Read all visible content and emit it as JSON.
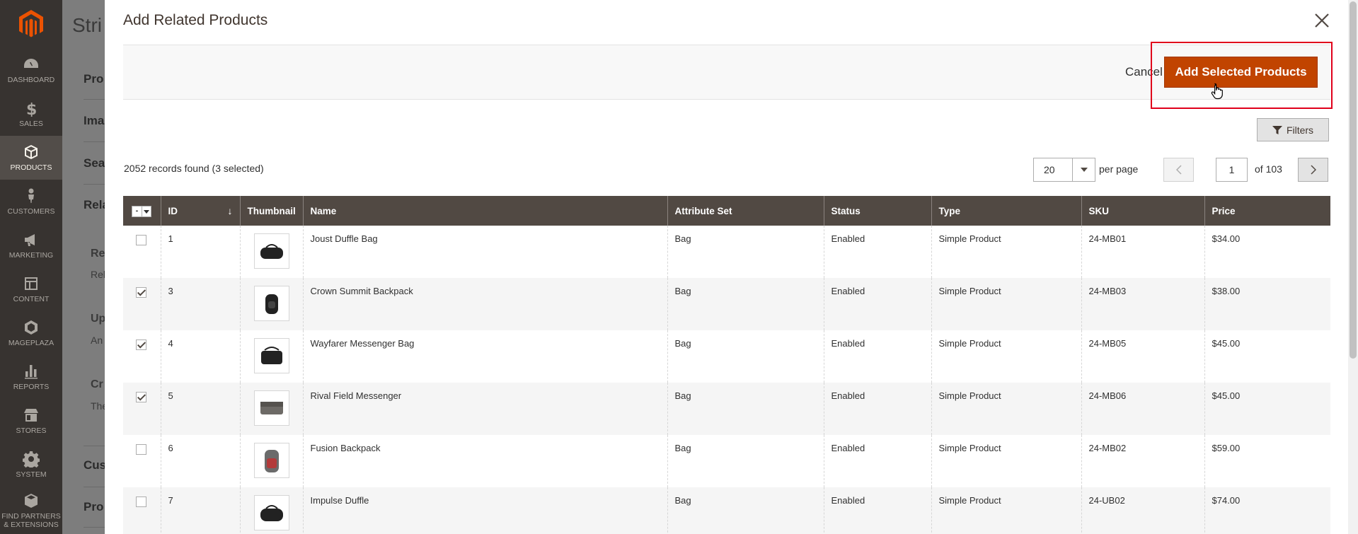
{
  "sidebar": {
    "items": [
      {
        "label": "DASHBOARD",
        "icon": "dashboard-icon"
      },
      {
        "label": "SALES",
        "icon": "dollar-icon"
      },
      {
        "label": "PRODUCTS",
        "icon": "cube-icon",
        "active": true
      },
      {
        "label": "CUSTOMERS",
        "icon": "person-icon"
      },
      {
        "label": "MARKETING",
        "icon": "megaphone-icon"
      },
      {
        "label": "CONTENT",
        "icon": "layout-icon"
      },
      {
        "label": "MAGEPLAZA",
        "icon": "hexagon-icon"
      },
      {
        "label": "REPORTS",
        "icon": "bar-chart-icon"
      },
      {
        "label": "STORES",
        "icon": "store-icon"
      },
      {
        "label": "SYSTEM",
        "icon": "gear-icon"
      },
      {
        "label": "FIND PARTNERS & EXTENSIONS",
        "icon": "box-icon"
      }
    ]
  },
  "background": {
    "title": "Stri",
    "items": [
      "Pro",
      "Ima",
      "Sea",
      "Rela",
      "Cus",
      "Pro"
    ],
    "subs": [
      "Re",
      "Rel",
      "Up",
      "An",
      "Cr",
      "The"
    ]
  },
  "modal": {
    "title": "Add Related Products",
    "cancel_label": "Cancel",
    "primary_label": "Add Selected Products",
    "filters_label": "Filters",
    "records_text": "2052 records found (3 selected)",
    "per_page_value": "20",
    "per_page_label": "per page",
    "current_page": "1",
    "page_of": "of 103"
  },
  "grid": {
    "columns": [
      "ID",
      "Thumbnail",
      "Name",
      "Attribute Set",
      "Status",
      "Type",
      "SKU",
      "Price"
    ],
    "mass_select_label": "-",
    "rows": [
      {
        "checked": false,
        "id": "1",
        "name": "Joust Duffle Bag",
        "attribute_set": "Bag",
        "status": "Enabled",
        "type": "Simple Product",
        "sku": "24-MB01",
        "price": "$34.00"
      },
      {
        "checked": true,
        "id": "3",
        "name": "Crown Summit Backpack",
        "attribute_set": "Bag",
        "status": "Enabled",
        "type": "Simple Product",
        "sku": "24-MB03",
        "price": "$38.00"
      },
      {
        "checked": true,
        "id": "4",
        "name": "Wayfarer Messenger Bag",
        "attribute_set": "Bag",
        "status": "Enabled",
        "type": "Simple Product",
        "sku": "24-MB05",
        "price": "$45.00"
      },
      {
        "checked": true,
        "id": "5",
        "name": "Rival Field Messenger",
        "attribute_set": "Bag",
        "status": "Enabled",
        "type": "Simple Product",
        "sku": "24-MB06",
        "price": "$45.00"
      },
      {
        "checked": false,
        "id": "6",
        "name": "Fusion Backpack",
        "attribute_set": "Bag",
        "status": "Enabled",
        "type": "Simple Product",
        "sku": "24-MB02",
        "price": "$59.00"
      },
      {
        "checked": false,
        "id": "7",
        "name": "Impulse Duffle",
        "attribute_set": "Bag",
        "status": "Enabled",
        "type": "Simple Product",
        "sku": "24-UB02",
        "price": "$74.00"
      }
    ]
  },
  "colors": {
    "sidebar_bg": "#373330",
    "header_bg": "#514943",
    "primary_button": "#c14400",
    "logo": "#eb5202",
    "highlight": "#e0001b"
  }
}
